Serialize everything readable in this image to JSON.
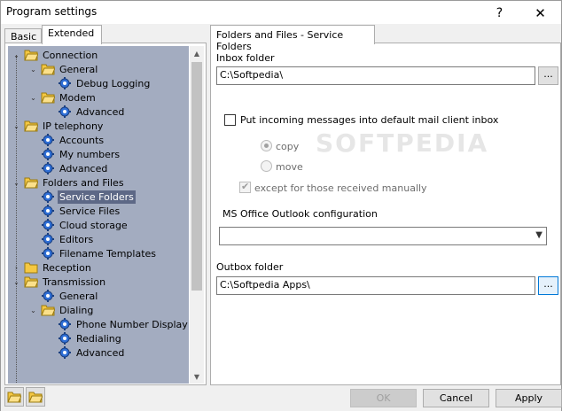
{
  "window": {
    "title": "Program settings",
    "help": "?",
    "close": "✕"
  },
  "left_tabs": [
    "Basic",
    "Extended"
  ],
  "tree": [
    {
      "label": "Connection",
      "level": 0,
      "expander": "v",
      "icon": "folder-open"
    },
    {
      "label": "General",
      "level": 1,
      "expander": "v",
      "icon": "folder-open"
    },
    {
      "label": "Debug Logging",
      "level": 2,
      "expander": "",
      "icon": "gear"
    },
    {
      "label": "Modem",
      "level": 1,
      "expander": "v",
      "icon": "folder-open"
    },
    {
      "label": "Advanced",
      "level": 2,
      "expander": "",
      "icon": "gear"
    },
    {
      "label": "IP telephony",
      "level": 0,
      "expander": "v",
      "icon": "folder-open"
    },
    {
      "label": "Accounts",
      "level": 1,
      "expander": "",
      "icon": "gear"
    },
    {
      "label": "My numbers",
      "level": 1,
      "expander": "",
      "icon": "gear"
    },
    {
      "label": "Advanced",
      "level": 1,
      "expander": "",
      "icon": "gear"
    },
    {
      "label": "Folders and Files",
      "level": 0,
      "expander": "v",
      "icon": "folder-open"
    },
    {
      "label": "Service Folders",
      "level": 1,
      "expander": "",
      "icon": "gear",
      "selected": true
    },
    {
      "label": "Service Files",
      "level": 1,
      "expander": "",
      "icon": "gear"
    },
    {
      "label": "Cloud storage",
      "level": 1,
      "expander": "",
      "icon": "gear"
    },
    {
      "label": "Editors",
      "level": 1,
      "expander": "",
      "icon": "gear"
    },
    {
      "label": "Filename Templates",
      "level": 1,
      "expander": "",
      "icon": "gear"
    },
    {
      "label": "Reception",
      "level": 0,
      "expander": ">",
      "icon": "folder-closed"
    },
    {
      "label": "Transmission",
      "level": 0,
      "expander": "v",
      "icon": "folder-open"
    },
    {
      "label": "General",
      "level": 1,
      "expander": "",
      "icon": "gear"
    },
    {
      "label": "Dialing",
      "level": 1,
      "expander": "v",
      "icon": "folder-open"
    },
    {
      "label": "Phone Number Display",
      "level": 2,
      "expander": "",
      "icon": "gear"
    },
    {
      "label": "Redialing",
      "level": 2,
      "expander": "",
      "icon": "gear"
    },
    {
      "label": "Advanced",
      "level": 2,
      "expander": "",
      "icon": "gear"
    }
  ],
  "right_tab": "Folders and Files - Service Folders",
  "inbox": {
    "label": "Inbox folder",
    "value": "C:\\Softpedia\\",
    "browse": "..."
  },
  "put_incoming": {
    "label": "Put incoming messages into default mail client inbox",
    "checked": false
  },
  "radio_copy": {
    "label": "copy",
    "selected": true
  },
  "radio_move": {
    "label": "move",
    "selected": false
  },
  "except_manual": {
    "label": "except for those received manually",
    "checked": true
  },
  "outlook": {
    "label": "MS Office Outlook configuration",
    "value": ""
  },
  "outbox": {
    "label": "Outbox folder",
    "value": "C:\\Softpedia Apps\\",
    "browse": "..."
  },
  "watermark": "SOFTPEDIA",
  "buttons": {
    "ok": "OK",
    "cancel": "Cancel",
    "apply": "Apply"
  },
  "colors": {
    "tree_bg": "#a3acc0",
    "selection": "#5d6886",
    "folder": "#f5c842",
    "gear": "#2f6fd6"
  }
}
